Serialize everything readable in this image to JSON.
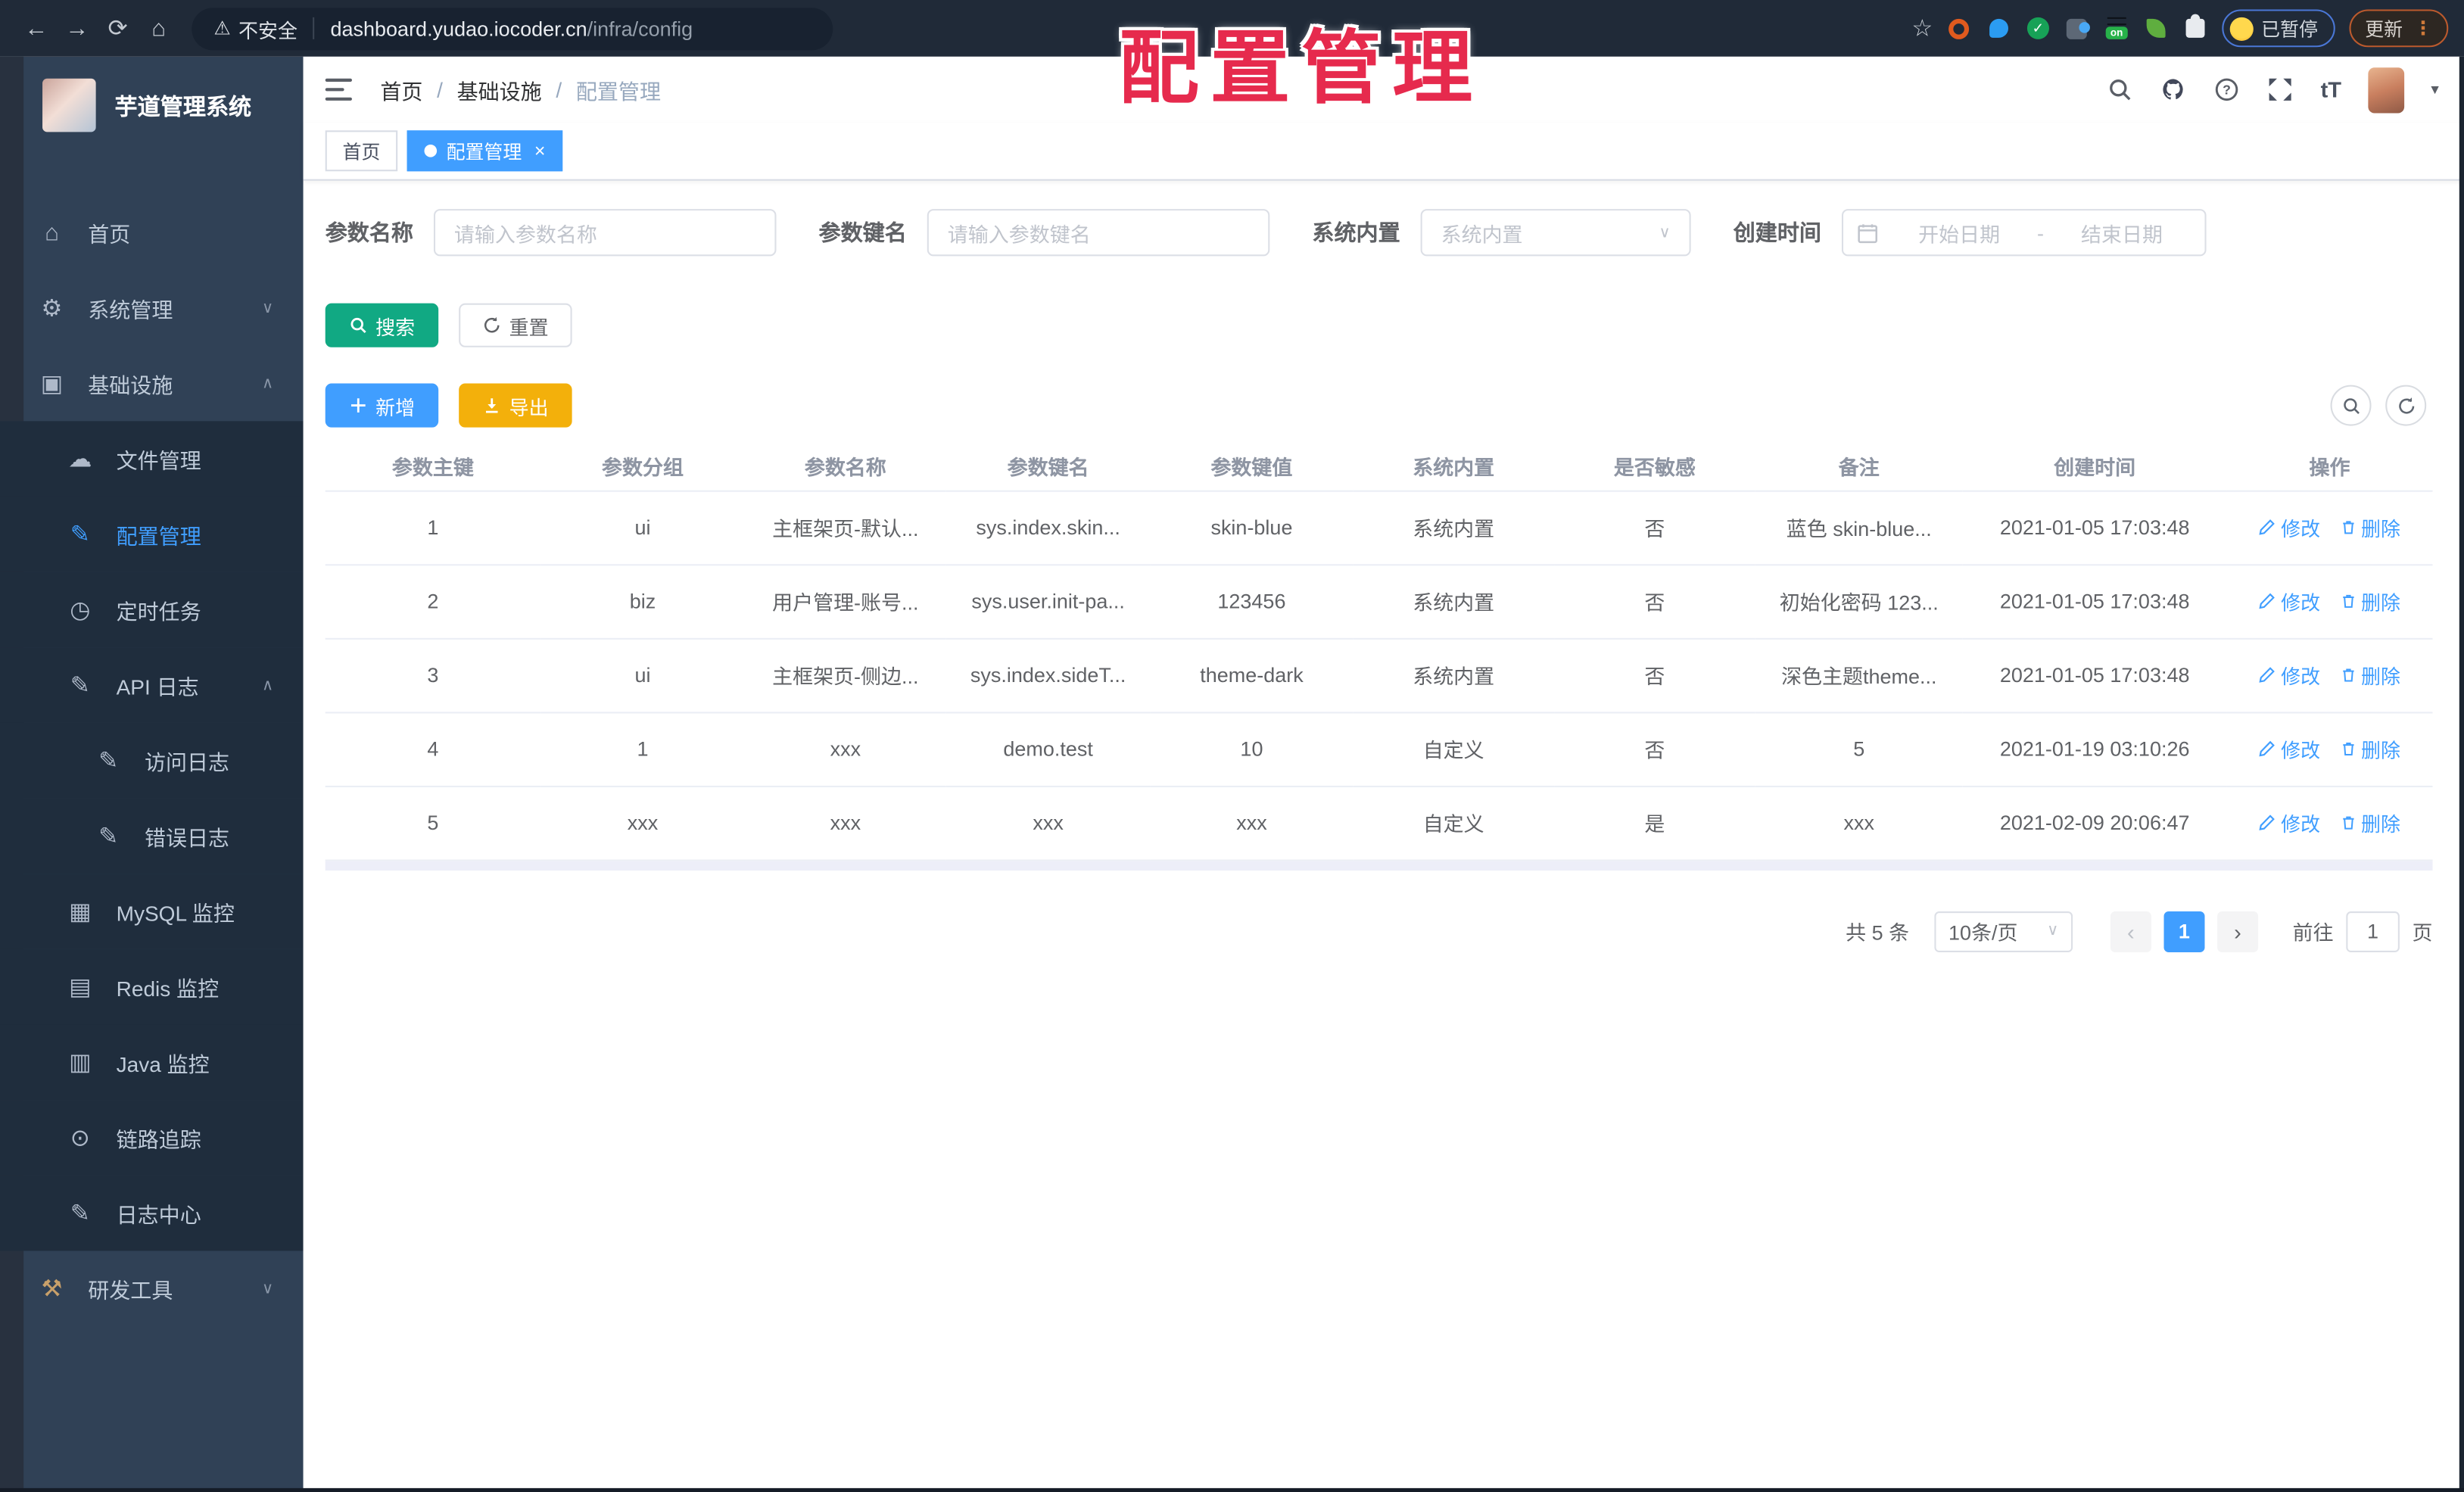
{
  "browser": {
    "security_label": "不安全",
    "url_host": "dashboard.yudao.iocoder.cn",
    "url_path": "/infra/config",
    "on_badge_text": "on",
    "paused_badge": "已暂停",
    "update_button": "更新"
  },
  "overlay": {
    "title": "配置管理",
    "color": "#e62a4d"
  },
  "sidebar": {
    "app_title": "芋道管理系统",
    "menu": [
      {
        "label": "首页",
        "icon": "home-icon",
        "level": 1
      },
      {
        "label": "系统管理",
        "icon": "gear-icon",
        "level": 1,
        "chevron": "down"
      },
      {
        "label": "基础设施",
        "icon": "infrastructure-icon",
        "level": 1,
        "chevron": "up"
      },
      {
        "label": "文件管理",
        "icon": "file-cloud-icon",
        "level": 2
      },
      {
        "label": "配置管理",
        "icon": "config-edit-icon",
        "level": 2,
        "active": true
      },
      {
        "label": "定时任务",
        "icon": "timer-icon",
        "level": 2
      },
      {
        "label": "API 日志",
        "icon": "api-log-icon",
        "level": 2,
        "chevron": "up"
      },
      {
        "label": "访问日志",
        "icon": "access-log-icon",
        "level": 3
      },
      {
        "label": "错误日志",
        "icon": "error-log-icon",
        "level": 3
      },
      {
        "label": "MySQL 监控",
        "icon": "mysql-icon",
        "level": 2
      },
      {
        "label": "Redis 监控",
        "icon": "redis-icon",
        "level": 2
      },
      {
        "label": "Java 监控",
        "icon": "java-icon",
        "level": 2
      },
      {
        "label": "链路追踪",
        "icon": "trace-eye-icon",
        "level": 2
      },
      {
        "label": "日志中心",
        "icon": "log-center-icon",
        "level": 2
      },
      {
        "label": "研发工具",
        "icon": "devtools-icon",
        "level": 1,
        "chevron": "down"
      }
    ]
  },
  "navbar": {
    "breadcrumb": [
      "首页",
      "基础设施",
      "配置管理"
    ],
    "font_size_icon_text": "tT"
  },
  "tabbar": {
    "tabs": [
      {
        "label": "首页",
        "active": false,
        "closable": false
      },
      {
        "label": "配置管理",
        "active": true,
        "closable": true
      }
    ]
  },
  "filters": {
    "name": {
      "label": "参数名称",
      "placeholder": "请输入参数名称",
      "value": ""
    },
    "key": {
      "label": "参数键名",
      "placeholder": "请输入参数键名",
      "value": ""
    },
    "type": {
      "label": "系统内置",
      "placeholder": "系统内置",
      "value": ""
    },
    "date": {
      "label": "创建时间",
      "start_placeholder": "开始日期",
      "separator": "-",
      "end_placeholder": "结束日期"
    }
  },
  "actions": {
    "search": "搜索",
    "reset": "重置",
    "add": "新增",
    "export": "导出"
  },
  "table": {
    "columns": [
      "参数主键",
      "参数分组",
      "参数名称",
      "参数键名",
      "参数键值",
      "系统内置",
      "是否敏感",
      "备注",
      "创建时间",
      "操作"
    ],
    "rows": [
      [
        "1",
        "ui",
        "主框架页-默认...",
        "sys.index.skin...",
        "skin-blue",
        "系统内置",
        "否",
        "蓝色 skin-blue...",
        "2021-01-05 17:03:48"
      ],
      [
        "2",
        "biz",
        "用户管理-账号...",
        "sys.user.init-pa...",
        "123456",
        "系统内置",
        "否",
        "初始化密码 123...",
        "2021-01-05 17:03:48"
      ],
      [
        "3",
        "ui",
        "主框架页-侧边...",
        "sys.index.sideT...",
        "theme-dark",
        "系统内置",
        "否",
        "深色主题theme...",
        "2021-01-05 17:03:48"
      ],
      [
        "4",
        "1",
        "xxx",
        "demo.test",
        "10",
        "自定义",
        "否",
        "5",
        "2021-01-19 03:10:26"
      ],
      [
        "5",
        "xxx",
        "xxx",
        "xxx",
        "xxx",
        "自定义",
        "是",
        "xxx",
        "2021-02-09 20:06:47"
      ]
    ],
    "row_edit": "修改",
    "row_delete": "删除"
  },
  "pagination": {
    "total": "共 5 条",
    "page_size": "10条/页",
    "current_page": "1",
    "goto_label": "前往",
    "goto_value": "1",
    "goto_suffix": "页"
  },
  "colors": {
    "primary": "#409EFF",
    "search_green": "#11A983",
    "export_yellow": "#F3B00B",
    "sidebar_bg": "#304156",
    "submenu_bg": "#1F2D3D",
    "chrome_bg": "#202A38",
    "overlay_red": "#E62A4D"
  }
}
